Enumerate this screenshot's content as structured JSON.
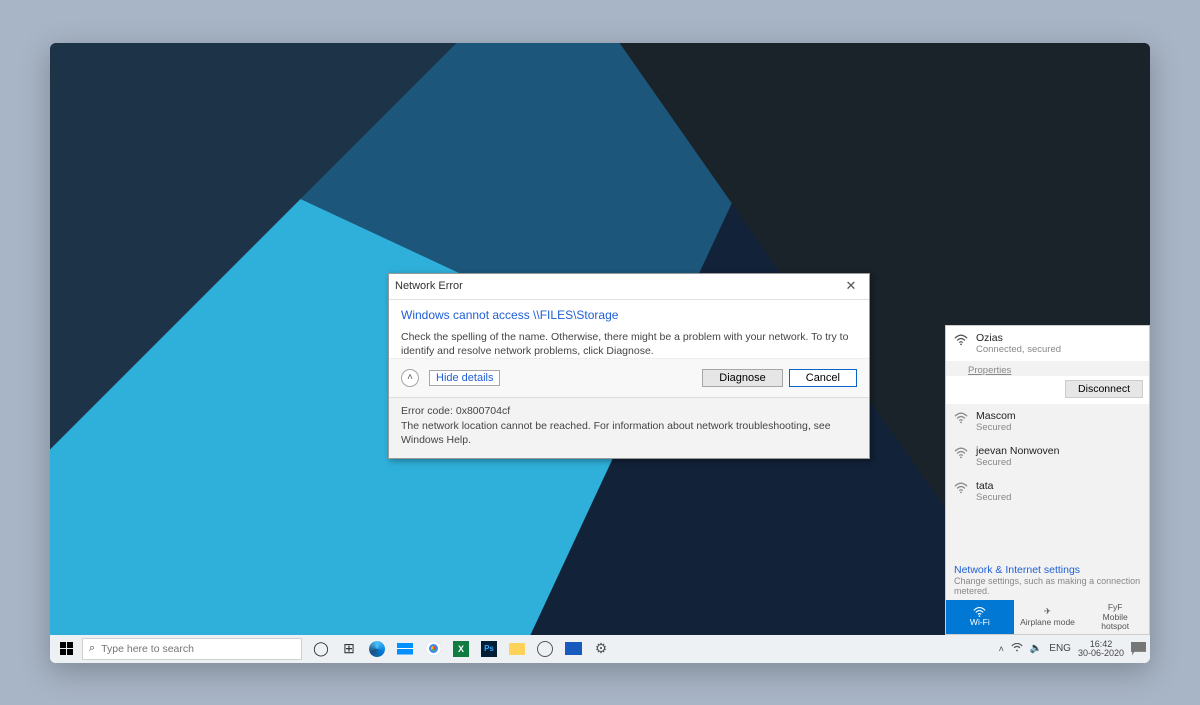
{
  "dialog": {
    "title": "Network Error",
    "heading": "Windows cannot access \\\\FILES\\Storage",
    "description": "Check the spelling of the name. Otherwise, there might be a problem with your network. To try to identify and resolve network problems, click Diagnose.",
    "toggle_label": "Hide details",
    "diagnose_label": "Diagnose",
    "cancel_label": "Cancel",
    "details_code": "Error code: 0x800704cf",
    "details_text": "The network location cannot be reached. For information about network troubleshooting, see Windows Help."
  },
  "network": {
    "connected": {
      "name": "Ozias",
      "status": "Connected, secured"
    },
    "properties_label": "Properties",
    "disconnect_label": "Disconnect",
    "others": [
      {
        "name": "Mascom",
        "status": "Secured"
      },
      {
        "name": "jeevan Nonwoven",
        "status": "Secured"
      },
      {
        "name": "tata",
        "status": "Secured"
      }
    ],
    "footer_title": "Network & Internet settings",
    "footer_sub": "Change settings, such as making a connection metered.",
    "quick": {
      "wifi": "Wi-Fi",
      "airplane": "Airplane mode",
      "hotspot_line1": "FyF",
      "hotspot_line2": "Mobile",
      "hotspot_line3": "hotspot"
    }
  },
  "taskbar": {
    "search_placeholder": "Type here to search",
    "lang": "ENG",
    "time": "16:42",
    "date": "30-06-2020"
  }
}
